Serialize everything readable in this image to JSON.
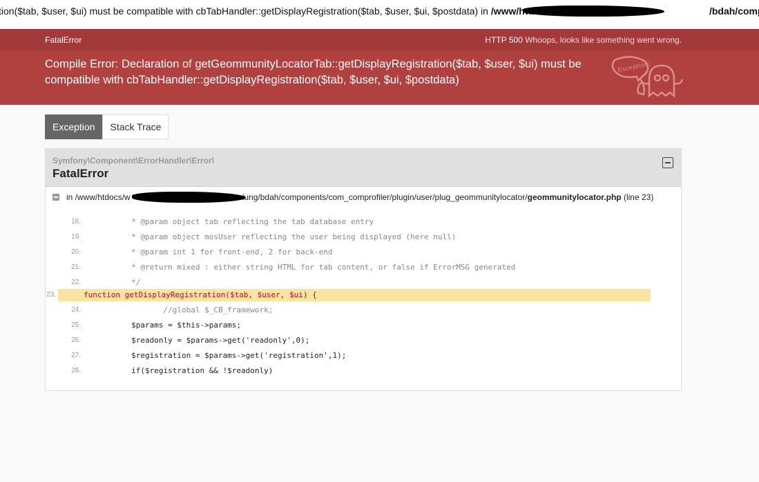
{
  "top_line": {
    "prefix": "tion($tab, $user, $ui) must be compatible with cbTabHandler::getDisplayRegistration($tab, $user, $ui, $postdata) in ",
    "path_start": "/www/htdocs/w",
    "path_end": "/bdah/components/com"
  },
  "header": {
    "exception_type": "FatalError",
    "status_code": "HTTP 500",
    "status_text": "Whoops, looks like something went wrong."
  },
  "message": {
    "text": "Compile Error: Declaration of getGeommunityLocatorTab::getDisplayRegistration($tab, $user, $ui) must be compatible with cbTabHandler::getDisplayRegistration($tab, $user, $ui, $postdata)",
    "illustration_label": "Exception!"
  },
  "tabs": [
    {
      "label": "Exception",
      "active": true
    },
    {
      "label": "Stack Trace",
      "active": false
    }
  ],
  "exception_panel": {
    "namespace": "Symfony\\Component\\ErrorHandler\\Error\\",
    "class_name": "FatalError",
    "file_prefix": "in /www/htdocs/w",
    "file_path_tail": "lung/bdah/components/com_comprofiler/plugin/user/plug_geommunitylocator/",
    "file_name": "geommunitylocator.php",
    "line_info": "(line 23)"
  },
  "code_lines": [
    {
      "num": "18.",
      "text": "     * @param object tab reflecting the tab database entry"
    },
    {
      "num": "19.",
      "text": "     * @param object mosUser reflecting the user being displayed (here null)"
    },
    {
      "num": "20.",
      "text": "     * @param int 1 for front-end, 2 for back-end"
    },
    {
      "num": "21.",
      "text": "     * @return mixed : either string HTML for tab content, or false if ErrorMSG generated"
    },
    {
      "num": "22.",
      "text": "     */"
    },
    {
      "num": "23.",
      "text": "function getDisplayRegistration($tab, $user, $ui) {"
    },
    {
      "num": "24.",
      "text": "            //global $_CB_framework;"
    },
    {
      "num": "25.",
      "text": "     $params = $this->params;"
    },
    {
      "num": "26.",
      "text": "     $readonly = $params->get('readonly',0);"
    },
    {
      "num": "27.",
      "text": "     $registration = $params->get('registration',1);"
    },
    {
      "num": "28.",
      "text": "     if($registration && !$readonly)"
    }
  ],
  "colors": {
    "header_bg": "#a33a39",
    "message_bg": "#b0413e",
    "highlight_line": "#f8e6a0",
    "active_tab": "#666666"
  }
}
